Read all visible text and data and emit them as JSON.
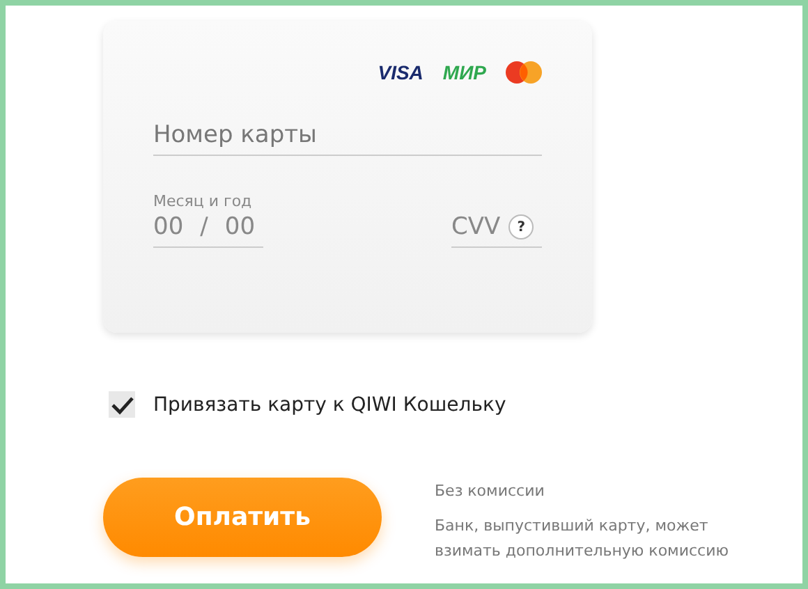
{
  "card_form": {
    "brands": [
      {
        "kind": "visa",
        "label": "VISA"
      },
      {
        "kind": "mir",
        "label": "МИР"
      },
      {
        "kind": "mastercard"
      }
    ],
    "card_number": {
      "placeholder": "Номер карты"
    },
    "expiry": {
      "label": "Месяц и год",
      "month_placeholder": "00",
      "separator": "/",
      "year_placeholder": "00"
    },
    "cvv": {
      "placeholder": "CVV",
      "help": "?"
    }
  },
  "link_checkbox": {
    "label": "Привязать карту к QIWI Кошельку",
    "checked": true
  },
  "pay_button": {
    "label": "Оплатить"
  },
  "fee_note": {
    "title": "Без комиссии",
    "text": "Банк, выпустивший карту, может взимать дополнительную комиссию"
  }
}
